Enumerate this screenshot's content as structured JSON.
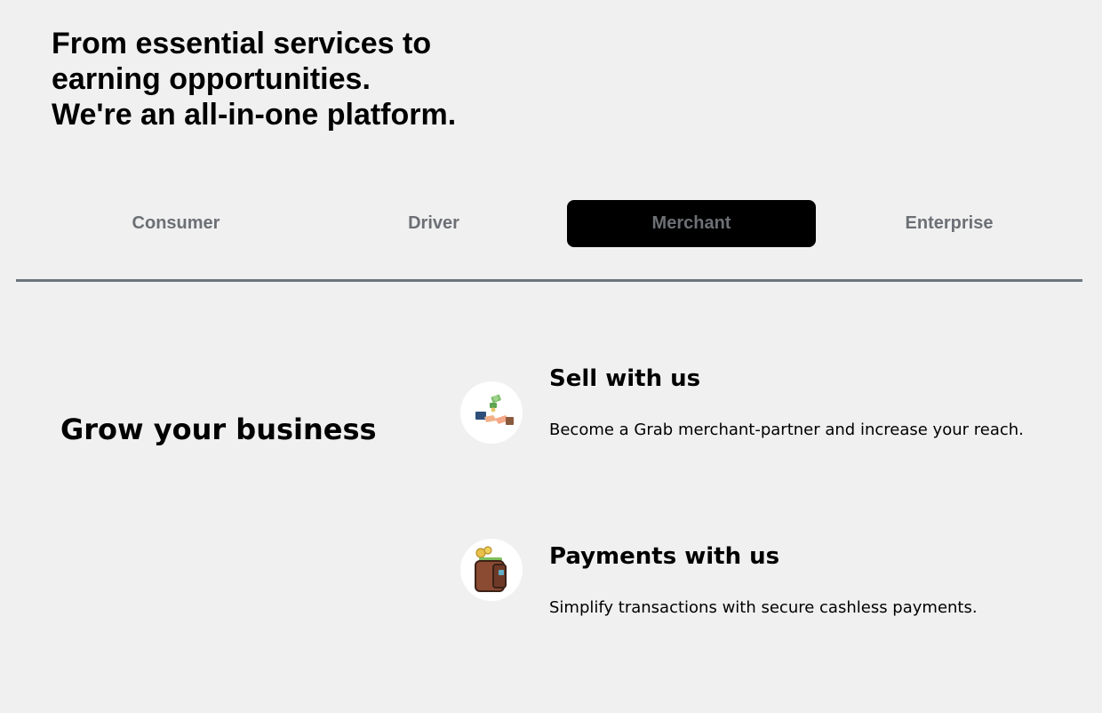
{
  "hero": {
    "title_lines": [
      "From essential services to",
      "earning opportunities.",
      "We're an all-in-one platform."
    ]
  },
  "tabs": [
    {
      "label": "Consumer",
      "active": false
    },
    {
      "label": "Driver",
      "active": false
    },
    {
      "label": "Merchant",
      "active": true
    },
    {
      "label": "Enterprise",
      "active": false
    }
  ],
  "merchant_section": {
    "heading": "Grow your business",
    "features": [
      {
        "icon": "handshake-money-icon",
        "title": "Sell with us",
        "description": "Become a Grab merchant-partner and increase your reach."
      },
      {
        "icon": "wallet-icon",
        "title": "Payments with us",
        "description": "Simplify transactions with secure cashless payments."
      }
    ]
  },
  "colors": {
    "background": "#f0f0f0",
    "tab_text": "#6c7075",
    "active_tab_bg": "#000000",
    "divider": "#6c757d"
  }
}
